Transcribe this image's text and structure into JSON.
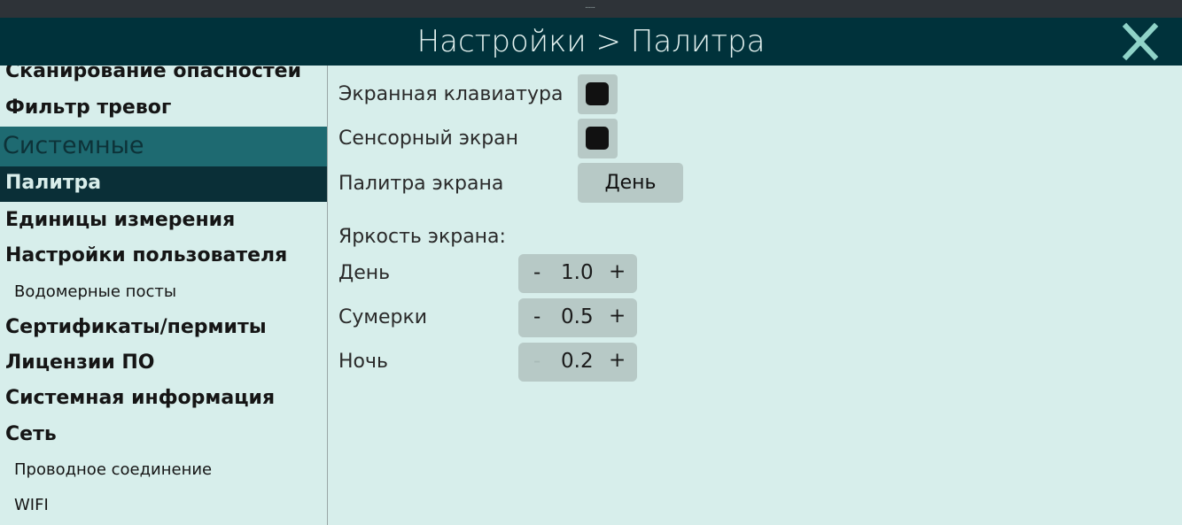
{
  "window": {
    "grip": "......"
  },
  "header": {
    "title": "Настройки > Палитра",
    "close_icon": "close-x-icon",
    "close_color": "#8fd3c8"
  },
  "sidebar": {
    "items_before": [
      "Сканирование опасностей",
      "Фильтр тревог"
    ],
    "section": "Системные",
    "selected": "Палитра",
    "items": [
      {
        "label": "Единицы измерения",
        "level": 1
      },
      {
        "label": "Настройки пользователя",
        "level": 1
      },
      {
        "label": "Водомерные посты",
        "level": 2
      },
      {
        "label": "Сертификаты/пермиты",
        "level": 1
      },
      {
        "label": "Лицензии ПО",
        "level": 1
      },
      {
        "label": "Системная информация",
        "level": 1
      },
      {
        "label": "Сеть",
        "level": 1
      },
      {
        "label": "Проводное соединение",
        "level": 2
      },
      {
        "label": "WIFI",
        "level": 2
      }
    ]
  },
  "main": {
    "onscreen_keyboard": {
      "label": "Экранная клавиатура",
      "checked": false
    },
    "touch_screen": {
      "label": "Сенсорный экран",
      "checked": false
    },
    "palette": {
      "label": "Палитра экрана",
      "value": "День"
    },
    "brightness": {
      "label": "Яркость экрана:",
      "rows": [
        {
          "label": "День",
          "value": "1.0",
          "minus": "-",
          "plus": "+",
          "minus_enabled": true
        },
        {
          "label": "Сумерки",
          "value": "0.5",
          "minus": "-",
          "plus": "+",
          "minus_enabled": true
        },
        {
          "label": "Ночь",
          "value": "0.2",
          "minus": "-",
          "plus": "+",
          "minus_enabled": false
        }
      ]
    }
  }
}
